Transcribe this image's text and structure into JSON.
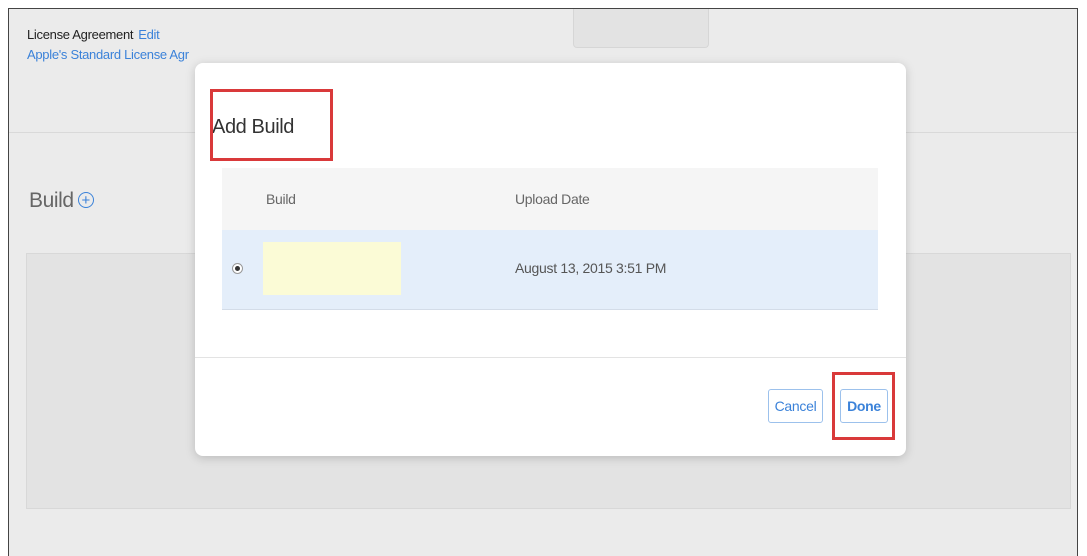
{
  "background": {
    "license_label": "License Agreement",
    "license_edit": "Edit",
    "license_link": "Apple's Standard License Agr",
    "build_heading": "Build",
    "add_build_icon": "plus-circle-icon"
  },
  "modal": {
    "title": "Add Build",
    "table": {
      "columns": [
        "Build",
        "Upload Date"
      ],
      "rows": [
        {
          "selected": true,
          "build": "",
          "upload_date": "August 13, 2015 3:51 PM"
        }
      ]
    },
    "cancel_label": "Cancel",
    "done_label": "Done"
  },
  "colors": {
    "accent": "#3b82d9",
    "highlight": "#d9393a",
    "selected_row": "#e4eefa",
    "build_redacted": "#fbfbd6"
  }
}
